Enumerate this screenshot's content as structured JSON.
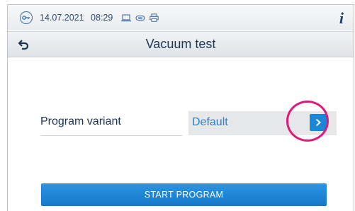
{
  "statusbar": {
    "date": "14.07.2021",
    "time": "08:29",
    "key_icon": "key-icon",
    "icons": [
      "laptop-icon",
      "usb-icon",
      "printer-icon"
    ],
    "info_icon": "info-icon",
    "info_glyph": "i"
  },
  "titlebar": {
    "back_icon": "back-arrow-icon",
    "title": "Vacuum test"
  },
  "program_variant": {
    "label": "Program variant",
    "value": "Default",
    "arrow_icon": "chevron-right-icon"
  },
  "actions": {
    "start_label": "START PROGRAM"
  },
  "colors": {
    "accent": "#1a86d8",
    "highlight": "#e0197a",
    "text_dark": "#1e3554",
    "value_text": "#2a7fd0"
  }
}
